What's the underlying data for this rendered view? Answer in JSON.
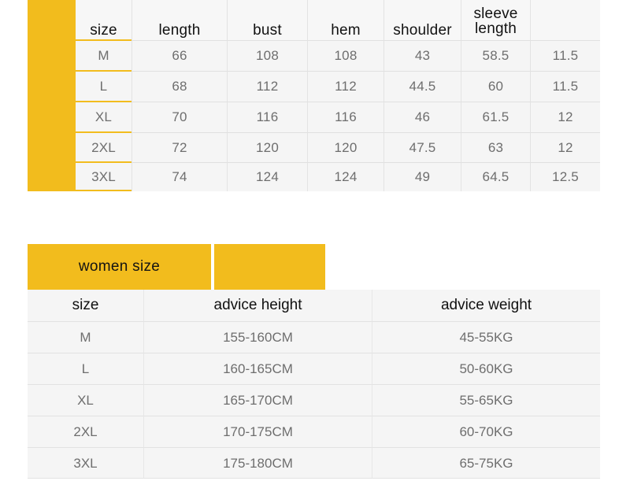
{
  "theme": {
    "accent_yellow": "#F2BC1D",
    "table_bg": "#F5F5F5",
    "header_text": "#111111",
    "cell_text": "#6E6E6E",
    "rule_gray": "#E2E2E2"
  },
  "garment_table": {
    "columns": [
      "size",
      "length",
      "bust",
      "hem",
      "shoulder",
      "sleeve length",
      ""
    ],
    "rows": [
      {
        "size": "M",
        "length": "66",
        "bust": "108",
        "hem": "108",
        "shoulder": "43",
        "sleeve_length": "58.5",
        "extra": "11.5"
      },
      {
        "size": "L",
        "length": "68",
        "bust": "112",
        "hem": "112",
        "shoulder": "44.5",
        "sleeve_length": "60",
        "extra": "11.5"
      },
      {
        "size": "XL",
        "length": "70",
        "bust": "116",
        "hem": "116",
        "shoulder": "46",
        "sleeve_length": "61.5",
        "extra": "12"
      },
      {
        "size": "2XL",
        "length": "72",
        "bust": "120",
        "hem": "120",
        "shoulder": "47.5",
        "sleeve_length": "63",
        "extra": "12"
      },
      {
        "size": "3XL",
        "length": "74",
        "bust": "124",
        "hem": "124",
        "shoulder": "49",
        "sleeve_length": "64.5",
        "extra": "12.5"
      }
    ]
  },
  "women_table": {
    "banner_title": "women size",
    "banner_secondary": "",
    "columns": [
      "size",
      "advice height",
      "advice weight"
    ],
    "rows": [
      {
        "size": "M",
        "advice_height": "155-160CM",
        "advice_weight": "45-55KG"
      },
      {
        "size": "L",
        "advice_height": "160-165CM",
        "advice_weight": "50-60KG"
      },
      {
        "size": "XL",
        "advice_height": "165-170CM",
        "advice_weight": "55-65KG"
      },
      {
        "size": "2XL",
        "advice_height": "170-175CM",
        "advice_weight": "60-70KG"
      },
      {
        "size": "3XL",
        "advice_height": "175-180CM",
        "advice_weight": "65-75KG"
      }
    ]
  }
}
